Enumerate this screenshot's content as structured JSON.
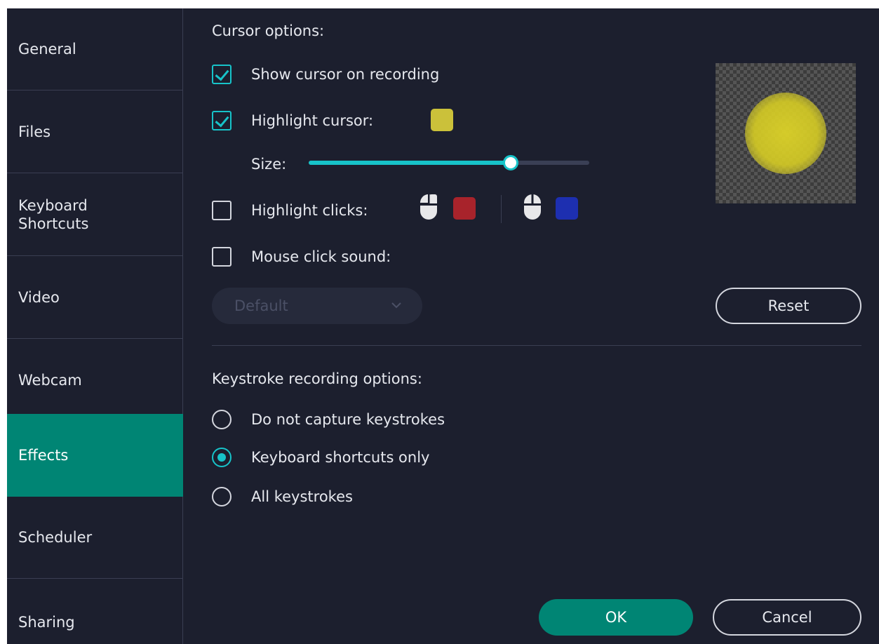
{
  "sidebar": {
    "items": [
      {
        "label": "General"
      },
      {
        "label": "Files"
      },
      {
        "label": "Keyboard\nShortcuts"
      },
      {
        "label": "Video"
      },
      {
        "label": "Webcam"
      },
      {
        "label": "Effects"
      },
      {
        "label": "Scheduler"
      },
      {
        "label": "Sharing"
      }
    ],
    "active_index": 5
  },
  "cursor": {
    "title": "Cursor options:",
    "show_cursor": {
      "label": "Show cursor on recording",
      "checked": true
    },
    "highlight_cursor": {
      "label": "Highlight cursor:",
      "checked": true,
      "color": "#cbc13a"
    },
    "size": {
      "label": "Size:",
      "value_fraction": 0.72
    },
    "highlight_clicks": {
      "label": "Highlight clicks:",
      "checked": false,
      "left_click_color": "#a8232b",
      "right_click_color": "#1d2fb0"
    },
    "click_sound": {
      "label": "Mouse click sound:",
      "checked": false
    },
    "sound_dropdown": {
      "value": "Default"
    },
    "reset_label": "Reset"
  },
  "keystrokes": {
    "title": "Keystroke recording options:",
    "options": [
      {
        "label": "Do not capture keystrokes",
        "selected": false
      },
      {
        "label": "Keyboard shortcuts only",
        "selected": true
      },
      {
        "label": "All keystrokes",
        "selected": false
      }
    ]
  },
  "footer": {
    "ok_label": "OK",
    "cancel_label": "Cancel"
  },
  "colors": {
    "accent": "#17c3c9",
    "active_nav": "#008574",
    "background": "#1c1f2e"
  }
}
